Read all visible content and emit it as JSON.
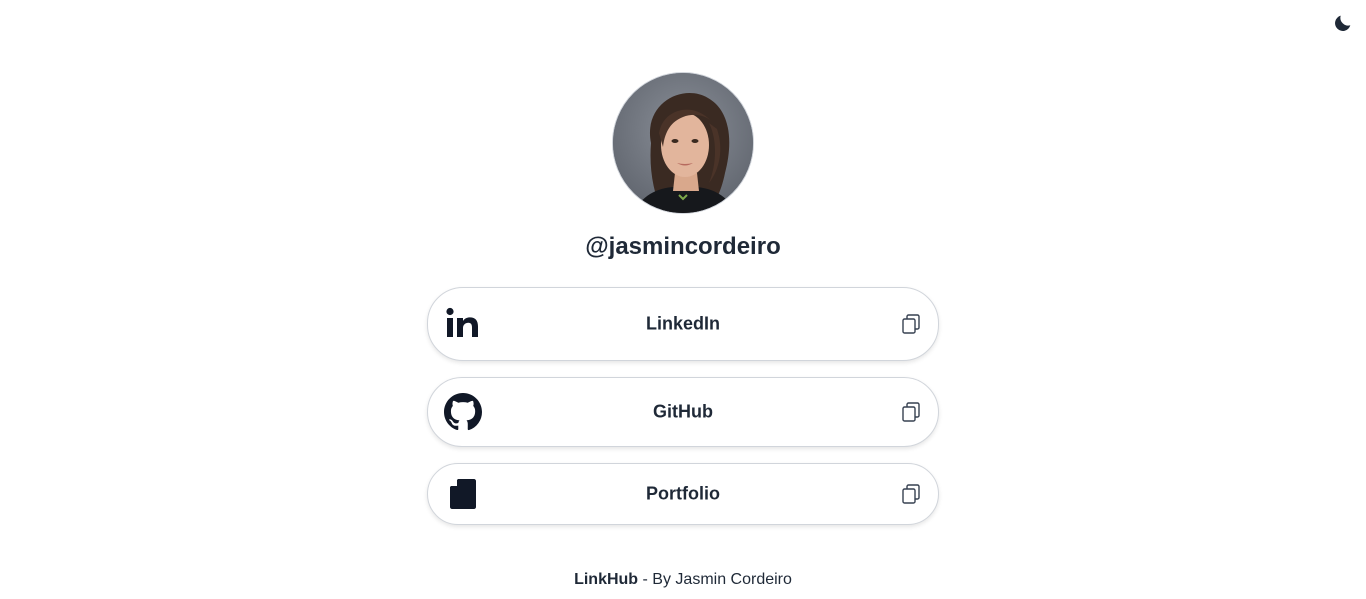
{
  "header": {
    "theme_toggle_icon": "moon-icon"
  },
  "profile": {
    "username": "@jasmincordeiro",
    "avatar_icon": "profile-photo"
  },
  "links": [
    {
      "label": "LinkedIn",
      "icon": "linkedin-icon",
      "action_icon": "copy-icon"
    },
    {
      "label": "GitHub",
      "icon": "github-icon",
      "action_icon": "copy-icon"
    },
    {
      "label": "Portfolio",
      "icon": "document-icon",
      "action_icon": "copy-icon"
    }
  ],
  "footer": {
    "brand": "LinkHub",
    "separator": " - ",
    "credit": "By Jasmin Cordeiro"
  },
  "colors": {
    "text": "#111827",
    "border": "#d1d5db",
    "background": "#ffffff"
  }
}
